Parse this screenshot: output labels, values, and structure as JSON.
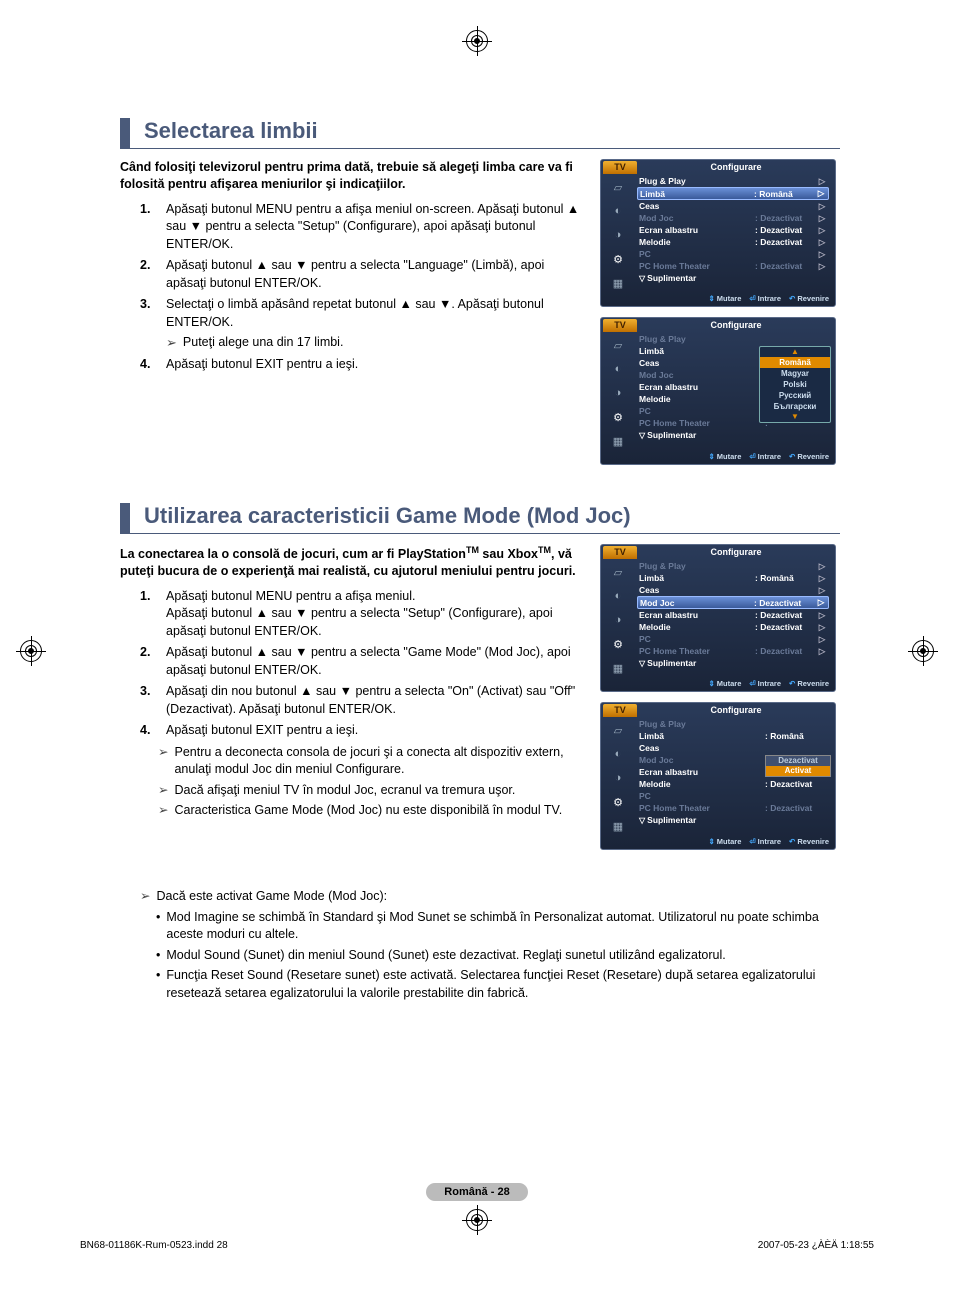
{
  "print_marks": true,
  "sections": {
    "s1": {
      "heading": "Selectarea limbii",
      "intro": "Când folosiţi televizorul pentru prima dată, trebuie să alegeţi limba care va fi folosită pentru afişarea meniurilor şi indicaţiilor.",
      "steps": {
        "1": "Apăsaţi butonul MENU pentru a afişa meniul on-screen. Apăsaţi butonul ▲ sau ▼ pentru a selecta \"Setup\" (Configurare), apoi apăsaţi butonul ENTER/OK.",
        "2": "Apăsaţi butonul ▲ sau ▼ pentru a selecta \"Language\" (Limbă), apoi apăsaţi butonul ENTER/OK.",
        "3": "Selectaţi o limbă apăsând repetat butonul ▲ sau ▼. Apăsaţi butonul ENTER/OK.",
        "3note": "Puteţi alege una din 17 limbi.",
        "4": "Apăsaţi butonul EXIT pentru a ieşi."
      }
    },
    "s2": {
      "heading": "Utilizarea caracteristicii Game Mode (Mod Joc)",
      "intro_a": "La conectarea la o consolă de jocuri, cum ar fi PlayStation",
      "intro_b": " sau Xbox",
      "intro_c": ", vă puteţi bucura de o experienţă mai realistă, cu ajutorul meniului pentru jocuri.",
      "tm": "TM",
      "steps": {
        "1a": "Apăsaţi butonul MENU pentru a afişa meniul.",
        "1b": "Apăsaţi butonul ▲ sau ▼ pentru a selecta \"Setup\" (Configurare), apoi apăsaţi butonul ENTER/OK.",
        "2": "Apăsaţi butonul ▲ sau ▼ pentru a selecta \"Game Mode\" (Mod Joc), apoi apăsaţi butonul ENTER/OK.",
        "3": "Apăsaţi din nou butonul ▲ sau ▼ pentru a selecta \"On\" (Activat) sau \"Off\" (Dezactivat). Apăsaţi butonul ENTER/OK.",
        "4": "Apăsaţi butonul EXIT pentru a ieşi."
      },
      "notes": {
        "n1": "Pentru a deconecta consola de jocuri şi a conecta alt dispozitiv extern, anulaţi modul Joc din meniul Configurare.",
        "n2": "Dacă afişaţi meniul TV în modul Joc, ecranul va tremura uşor.",
        "n3": "Caracteristica Game Mode (Mod Joc) nu este disponibilă în modul TV.",
        "n4": "Dacă este activat Game Mode (Mod Joc):"
      },
      "bullets": {
        "b1": "Mod Imagine se schimbă în Standard şi Mod Sunet se schimbă în Personalizat automat. Utilizatorul nu poate schimba aceste moduri cu altele.",
        "b2": "Modul Sound (Sunet) din meniul Sound (Sunet) este dezactivat. Reglaţi sunetul utilizând egalizatorul.",
        "b3": "Funcţia Reset Sound (Resetare sunet) este activată. Selectarea funcţiei Reset (Resetare) după setarea egalizatorului resetează setarea egalizatorului la valorile prestabilite din fabrică."
      }
    }
  },
  "osd": {
    "tv": "TV",
    "title": "Configurare",
    "items": {
      "pnp": "Plug & Play",
      "limba": "Limbă",
      "ceas": "Ceas",
      "modjoc": "Mod Joc",
      "ecran": "Ecran albastru",
      "melodie": "Melodie",
      "pc": "PC",
      "pcht": "PC Home Theater",
      "supl": "Suplimentar"
    },
    "vals": {
      "romana": ": Română",
      "romana_sp": ":  Română",
      "dez": ": Dezactivat",
      "col": ":",
      "dezactivat_sel": "Dezactivat",
      "activat": "Activat"
    },
    "langs": {
      "ro": "Română",
      "hu": "Magyar",
      "pl": "Polski",
      "ru": "Русский",
      "bg": "Български"
    },
    "footer": {
      "mutare": "Mutare",
      "intrare": "Intrare",
      "revenire": "Revenire"
    }
  },
  "page_label": "Română - 28",
  "doc_footer": {
    "left": "BN68-01186K-Rum-0523.indd   28",
    "right": "2007-05-23   ¿ÀÈÄ 1:18:55"
  }
}
